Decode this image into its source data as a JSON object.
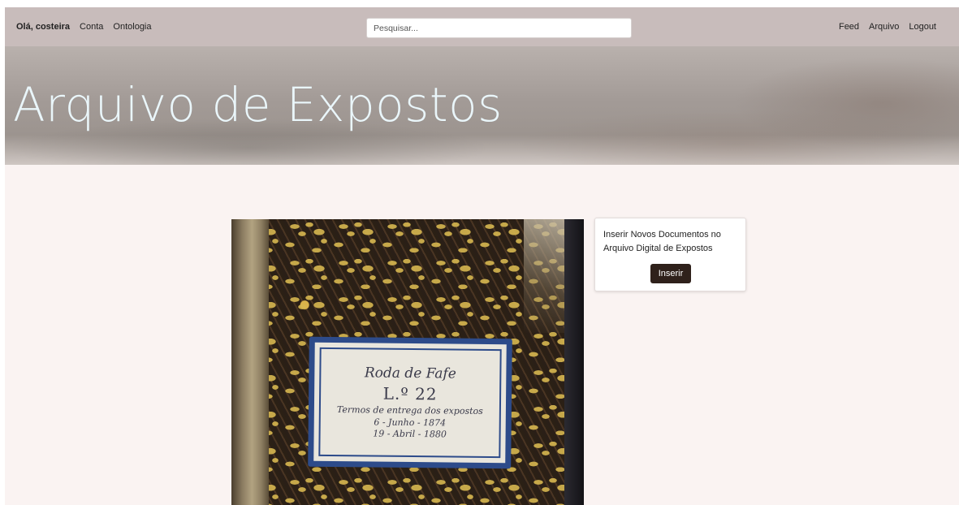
{
  "navbar": {
    "greeting": "Olá, costeira",
    "left_links": [
      "Conta",
      "Ontologia"
    ],
    "search_placeholder": "Pesquisar...",
    "right_links": [
      "Feed",
      "Arquivo",
      "Logout"
    ]
  },
  "hero": {
    "title": "Arquivo de Expostos"
  },
  "book_label": {
    "line1": "Roda de Fafe",
    "line2": "L.º 22",
    "line3": "Termos de entrega dos expostos",
    "line4": "6 - Junho - 1874",
    "line5": "19 - Abril - 1880"
  },
  "card": {
    "text": "Inserir Novos Documentos no Arquivo Digital de Expostos",
    "button_label": "Inserir"
  },
  "colors": {
    "navbar_bg": "#c8bcbb",
    "page_bg": "#faf3f2",
    "hero_title": "#eaf6fa",
    "button_bg": "#2f211b",
    "label_blue": "#2d4b8a"
  }
}
